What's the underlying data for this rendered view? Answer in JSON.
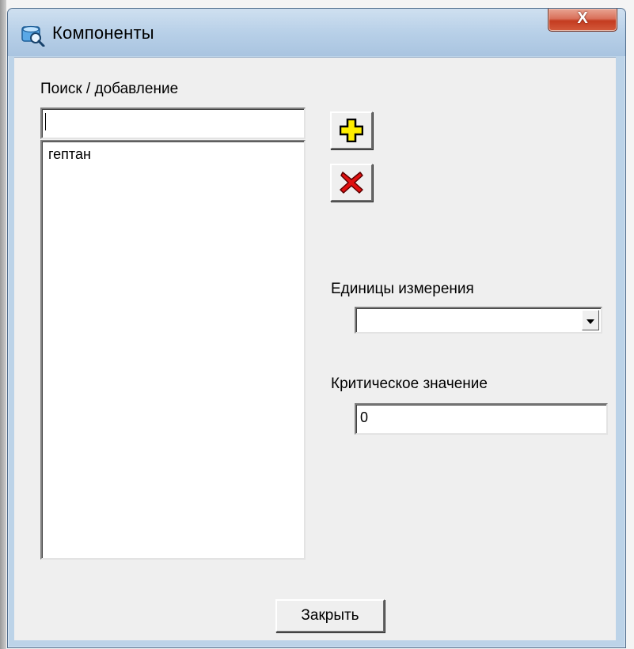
{
  "window": {
    "title": "Компоненты",
    "close_symbol": "X"
  },
  "search": {
    "label": "Поиск / добавление",
    "value": ""
  },
  "components_list": {
    "items": [
      "гептан"
    ]
  },
  "toolbar": {
    "add_icon": "plus-icon",
    "delete_icon": "red-x-icon"
  },
  "units": {
    "label": "Единицы измерения",
    "selected": ""
  },
  "critical": {
    "label": "Критическое значение",
    "value": "0"
  },
  "footer": {
    "close_label": "Закрыть"
  },
  "colors": {
    "add_icon_fill": "#ffee00",
    "delete_icon_fill": "#e01010",
    "titlebar": "#b8d0e8",
    "close_button": "#c43b20"
  }
}
